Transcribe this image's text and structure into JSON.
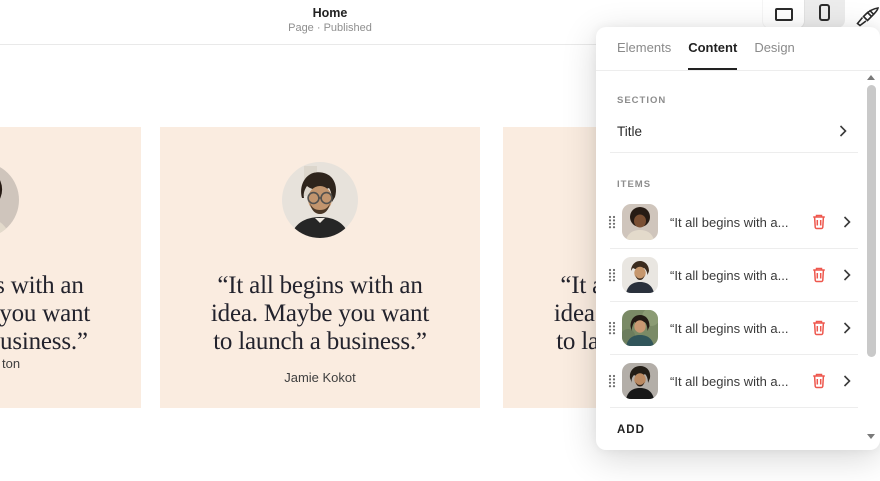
{
  "colors": {
    "card_background": "#faece0",
    "accent_red": "#ee574d",
    "tab_active": "#222222",
    "tab_inactive": "#8a8a8a"
  },
  "icons": {
    "desktop": "desktop-preview-icon",
    "mobile": "mobile-preview-icon",
    "brush": "paintbrush-icon",
    "drag": "drag-handle-icon",
    "trash": "trash-icon",
    "chevron": "chevron-right-icon",
    "scroll_up": "scroll-up-arrow-icon",
    "scroll_down": "scroll-down-arrow-icon"
  },
  "topbar": {
    "title": "Home",
    "subtitle": "Page · Published"
  },
  "panel": {
    "tabs": [
      {
        "label": "Elements",
        "active": false
      },
      {
        "label": "Content",
        "active": true
      },
      {
        "label": "Design",
        "active": false
      }
    ],
    "section_label": "SECTION",
    "section_rows": [
      {
        "title": "Title"
      }
    ],
    "items_label": "ITEMS",
    "items": [
      {
        "text": "“It all begins with a...",
        "avatar": "woman-afro"
      },
      {
        "text": "“It all begins with a...",
        "avatar": "man-beard"
      },
      {
        "text": "“It all begins with a...",
        "avatar": "woman-smiling"
      },
      {
        "text": "“It all begins with a...",
        "avatar": "man-dark-hair"
      }
    ],
    "add_label": "ADD"
  },
  "cards": {
    "quote_lines": [
      "“It all begins with an",
      "idea. Maybe you want",
      "to launch a business.”"
    ],
    "center": {
      "name": "Jamie Kokot",
      "avatar": "man-glasses"
    },
    "left": {
      "name_fragment": "ton",
      "avatar": "woman-afro"
    },
    "right": {
      "name": ""
    }
  }
}
